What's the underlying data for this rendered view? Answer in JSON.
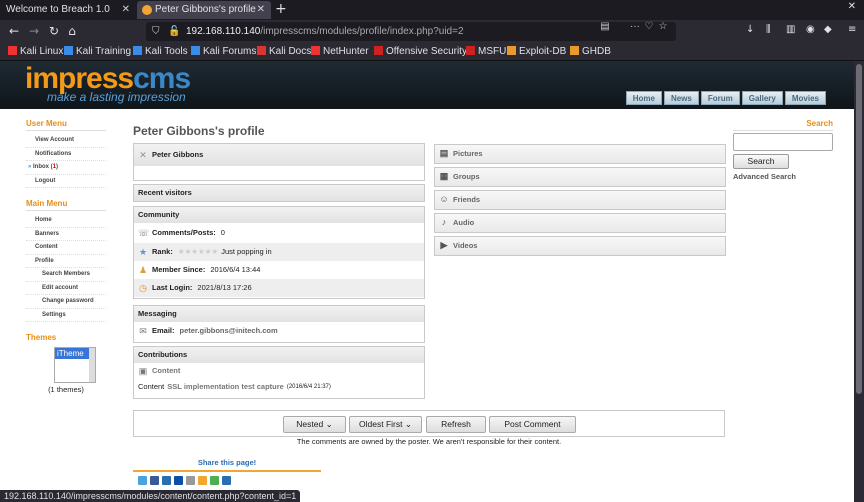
{
  "browser": {
    "tabs": [
      {
        "title": "Welcome to Breach 1.0",
        "active": false
      },
      {
        "title": "Peter Gibbons's profile",
        "active": true
      }
    ],
    "url_host": "192.168.110.140",
    "url_path": "/impresscms/modules/profile/index.php?uid=2",
    "bookmarks": [
      "Kali Linux",
      "Kali Training",
      "Kali Tools",
      "Kali Forums",
      "Kali Docs",
      "NetHunter",
      "Offensive Security",
      "MSFU",
      "Exploit-DB",
      "GHDB"
    ],
    "status_url": "192.168.110.140/impresscms/modules/content/content.php?content_id=1"
  },
  "site": {
    "logo_main": "impresscms",
    "logo_tagline": "make a lasting impression",
    "topnav": [
      "Home",
      "News",
      "Forum",
      "Gallery",
      "Movies"
    ]
  },
  "left": {
    "user_menu_title": "User Menu",
    "user_menu": [
      "View Account",
      "Notifications",
      "Inbox",
      "Logout"
    ],
    "inbox_count": "1",
    "main_menu_title": "Main Menu",
    "main_menu": [
      {
        "label": "Home",
        "sub": false
      },
      {
        "label": "Banners",
        "sub": false
      },
      {
        "label": "Content",
        "sub": false
      },
      {
        "label": "Profile",
        "sub": false
      },
      {
        "label": "Search Members",
        "sub": true
      },
      {
        "label": "Edit account",
        "sub": true
      },
      {
        "label": "Change password",
        "sub": true
      },
      {
        "label": "Settings",
        "sub": true
      }
    ],
    "themes_title": "Themes",
    "theme_selected": "iTheme",
    "themes_count": "(1 themes)"
  },
  "profile": {
    "page_title": "Peter Gibbons's profile",
    "name": "Peter Gibbons",
    "recent_visitors": "Recent visitors",
    "community_title": "Community",
    "comments_label": "Comments/Posts:",
    "comments_value": "0",
    "rank_label": "Rank:",
    "rank_value": "Just popping in",
    "member_since_label": "Member Since:",
    "member_since_value": "2016/6/4 13:44",
    "last_login_label": "Last Login:",
    "last_login_value": "2021/8/13 17:26",
    "messaging_title": "Messaging",
    "email_label": "Email:",
    "email_value": "peter.gibbons@initech.com",
    "contributions_title": "Contributions",
    "content_label": "Content",
    "content_prefix": "Content",
    "content_link": "SSL implementation test capture",
    "content_date": "(2016/6/4 21:37)"
  },
  "right_boxes": [
    "Pictures",
    "Groups",
    "Friends",
    "Audio",
    "Videos"
  ],
  "search": {
    "title": "Search",
    "button": "Search",
    "advanced": "Advanced Search"
  },
  "comments": {
    "mode": "Nested",
    "order": "Oldest First",
    "refresh": "Refresh",
    "post": "Post Comment",
    "note": "The comments are owned by the poster. We aren't responsible for their content.",
    "share_title": "Share this page!"
  },
  "colors": {
    "accent_orange": "#e58f14",
    "logo_blue": "#3b88c8",
    "header_dark": "#1f2a33"
  }
}
